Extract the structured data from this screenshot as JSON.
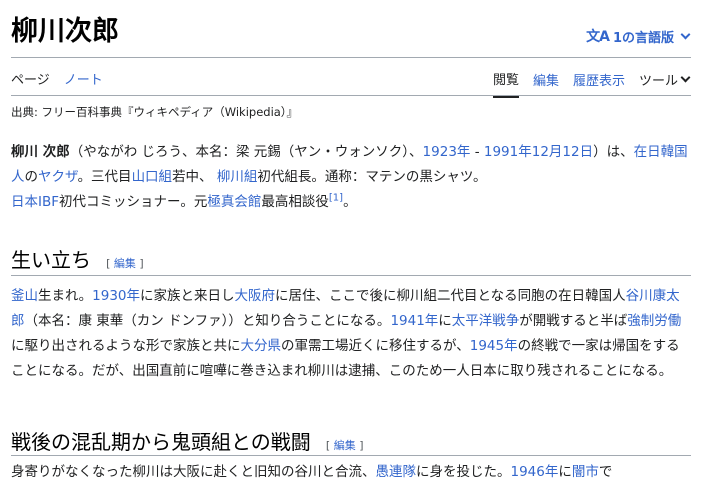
{
  "page": {
    "title": "柳川次郎",
    "lang_button": "1の言語版",
    "lang_icon": "文A"
  },
  "tabs": {
    "left": [
      "ページ",
      "ノート"
    ],
    "right": [
      "閲覧",
      "編集",
      "履歴表示"
    ],
    "tools": "ツール"
  },
  "source_line": "出典: フリー百科事典『ウィキペディア（Wikipedia）』",
  "intro": {
    "name": "柳川 次郎",
    "t1": "（やながわ じろう、本名：梁 元錫（ヤン・ウォンソク）、",
    "birth": "1923年",
    "dash": " - ",
    "death": "1991年12月12日",
    "t2": "）は、",
    "link1": "在日韓国人",
    "t3": "の",
    "link2": "ヤクザ",
    "t4": "。三代目",
    "link3": "山口組",
    "t5": "若中、 ",
    "link4": "柳川組",
    "t6": "初代組長。通称：マテンの黒シャツ。",
    "link5": "日本IBF",
    "t7": "初代コミッショナー。元",
    "link6": "極真会館",
    "t8": "最高相談役",
    "ref": "[1]",
    "t9": "。"
  },
  "section1": {
    "heading": "生い立ち",
    "edit_open": "[ ",
    "edit_label": "編集",
    "edit_close": " ]",
    "l1": "釜山",
    "s1": "生まれ。",
    "l2": "1930年",
    "s2": "に家族と来日し",
    "l3": "大阪府",
    "s3": "に居住、ここで後に柳川組二代目となる同胞の在日韓国人",
    "l4": "谷川康太郎",
    "s4": "（本名：康 東華（カン ドンファ））と知り合うことになる。",
    "l5": "1941年",
    "s5": "に",
    "l6": "太平洋戦争",
    "s6": "が開戦すると半ば",
    "l7": "強制労働",
    "s7": "に駆り出されるような形で家族と共に",
    "l8": "大分県",
    "s8": "の軍需工場近くに移住するが、",
    "l9": "1945年",
    "s9": "の終戦で一家は帰国をすることになる。だが、出国直前に喧嘩に巻き込まれ柳川は逮捕、このため一人日本に取り残されることになる。"
  },
  "section2": {
    "heading": "戦後の混乱期から鬼頭組との戦闘",
    "edit_open": "[ ",
    "edit_label": "編集",
    "edit_close": " ]",
    "s1": "身寄りがなくなった柳川は大阪に赴くと旧知の谷川と合流、",
    "l1": "愚連隊",
    "s2": "に身を投じた。",
    "l2": "1946年",
    "s3": "に",
    "l3": "闇市",
    "s4": "で"
  }
}
